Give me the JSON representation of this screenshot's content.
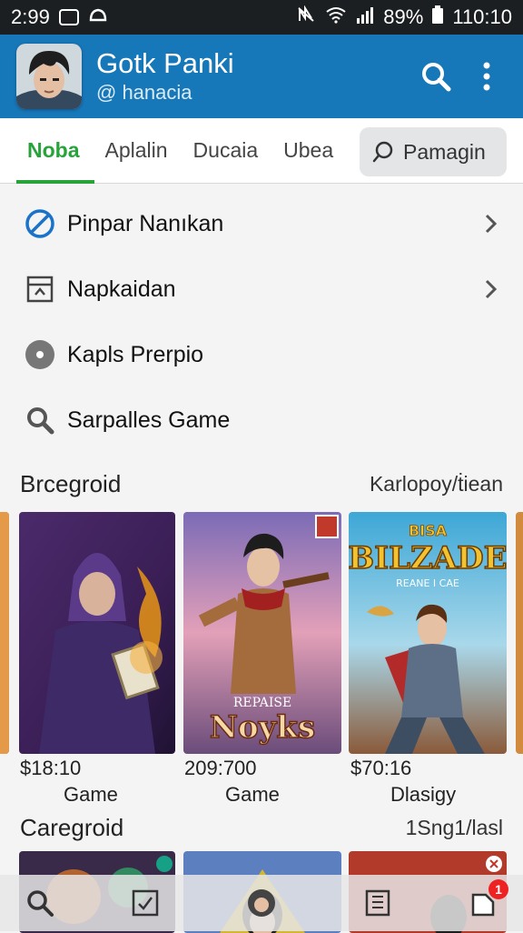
{
  "status_bar": {
    "time": "2:99",
    "battery": "89%",
    "clock": "110:10"
  },
  "header": {
    "title": "Gotk Panki",
    "subtitle": "@ hanacia"
  },
  "tabs": [
    {
      "label": "Noba",
      "active": true
    },
    {
      "label": "Aplalin"
    },
    {
      "label": "Ducaia"
    },
    {
      "label": "Ubea"
    }
  ],
  "tab_search": {
    "label": "Pamagin"
  },
  "menu": [
    {
      "label": "Pinpar Nanıkan",
      "icon": "blocked-icon",
      "chevron": true
    },
    {
      "label": "Napkaidan",
      "icon": "calendar-icon",
      "chevron": true
    },
    {
      "label": "Kapls Prerpio",
      "icon": "disc-icon",
      "chevron": false
    },
    {
      "label": "Sarpalles Game",
      "icon": "search-icon",
      "chevron": false
    }
  ],
  "section1": {
    "title": "Brcegroid",
    "link": "Karlopoy/ṫiean"
  },
  "cards": [
    {
      "price": "$18:10",
      "caption": "Game",
      "art_title": ""
    },
    {
      "price": "209:700",
      "caption": "Game",
      "art_title": "Noyks",
      "art_kicker": "REPAISE"
    },
    {
      "price": "$70:16",
      "caption": "Dlasigy",
      "art_title": "BILZADE",
      "art_kicker": "REANE I CAE",
      "art_top": "BISA"
    }
  ],
  "section2": {
    "title": "Caregroid",
    "link": "1Sng1/lasl"
  },
  "bottom_nav": {
    "badge_count": "1"
  },
  "colors": {
    "header": "#1677b9",
    "active_tab": "#27a33a",
    "status_bar": "#1b1f22"
  }
}
